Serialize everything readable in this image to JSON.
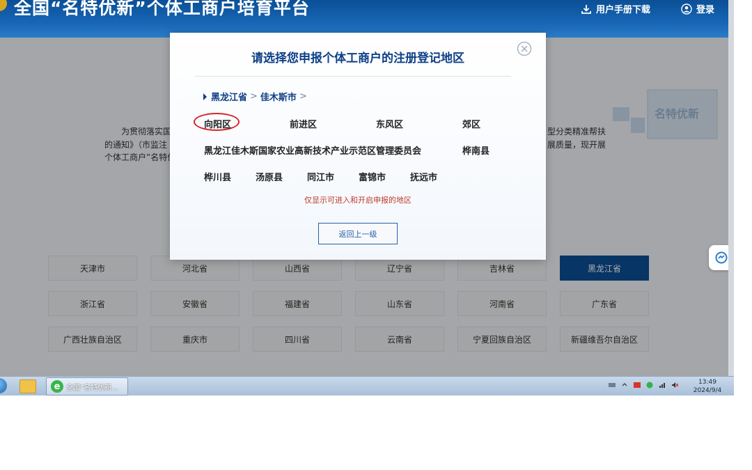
{
  "header": {
    "site_title": "全国“名特优新”个体工商户培育平台",
    "manual_link": "用户手册下载",
    "login_link": "登录"
  },
  "background": {
    "intro_lines": [
      "为贯彻落实国",
      "的通知》（市监注",
      "个体工商户”名特优",
      "型分类精准帮扶",
      "展质量，现开展"
    ],
    "illustration_text": "名特优新",
    "provinces": [
      {
        "label": "天津市",
        "active": false
      },
      {
        "label": "河北省",
        "active": false
      },
      {
        "label": "山西省",
        "active": false
      },
      {
        "label": "辽宁省",
        "active": false
      },
      {
        "label": "吉林省",
        "active": false
      },
      {
        "label": "黑龙江省",
        "active": true
      },
      {
        "label": "浙江省",
        "active": false
      },
      {
        "label": "安徽省",
        "active": false
      },
      {
        "label": "福建省",
        "active": false
      },
      {
        "label": "山东省",
        "active": false
      },
      {
        "label": "河南省",
        "active": false
      },
      {
        "label": "广东省",
        "active": false
      },
      {
        "label": "广西壮族自治区",
        "active": false
      },
      {
        "label": "重庆市",
        "active": false
      },
      {
        "label": "四川省",
        "active": false
      },
      {
        "label": "云南省",
        "active": false
      },
      {
        "label": "宁夏回族自治区",
        "active": false
      },
      {
        "label": "新疆维吾尔自治区",
        "active": false
      }
    ]
  },
  "modal": {
    "title": "请选择您申报个体工商户的注册登记地区",
    "breadcrumb": {
      "province": "黑龙江省",
      "city": "佳木斯市",
      "separator": ">"
    },
    "districts": [
      "向阳区",
      "前进区",
      "东风区",
      "郊区",
      "黑龙江佳木斯国家农业高新技术产业示范区管理委员会",
      "桦南县",
      "桦川县",
      "汤原县",
      "同江市",
      "富锦市",
      "抚远市"
    ],
    "hint": "仅显示可进入和开启申报的地区",
    "back_button": "返回上一级"
  },
  "taskbar": {
    "task_label": "全国“名特优新...",
    "time": "13:49",
    "date": "2024/9/4"
  },
  "colors": {
    "header_blue": "#0b4f96",
    "title_blue": "#0e3f86",
    "hint_red": "#c0392b",
    "circle_red": "#d8242b"
  }
}
